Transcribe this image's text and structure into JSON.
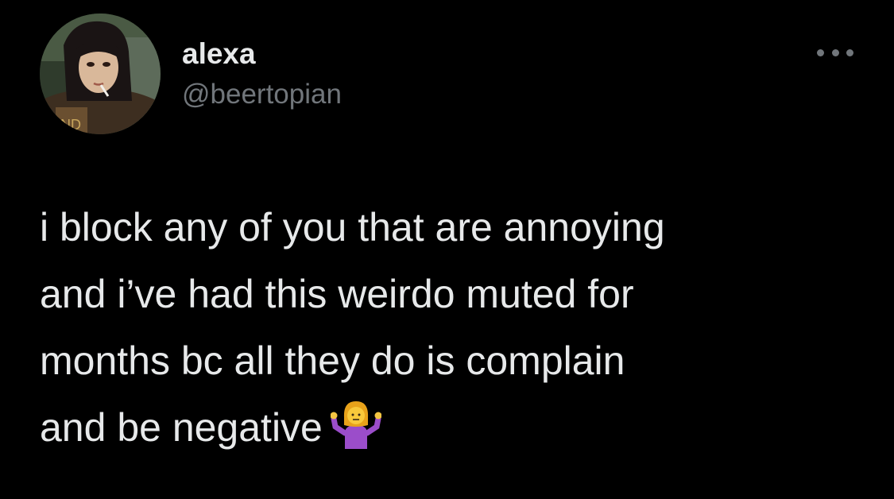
{
  "user": {
    "display_name": "alexa",
    "handle": "@beertopian"
  },
  "tweet": {
    "lines": [
      "i block any of you that are annoying",
      "and i’ve had this weirdo muted for",
      "months bc all they do is complain",
      "and be negative"
    ],
    "emoji": "person-shrugging-emoji"
  },
  "icons": {
    "more": "more-options-icon"
  },
  "colors": {
    "background": "#000000",
    "primary_text": "#e7e9ea",
    "secondary_text": "#71767b"
  }
}
